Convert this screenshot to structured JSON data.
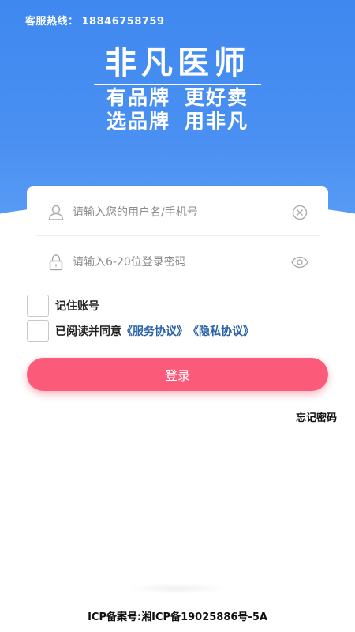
{
  "header": {
    "hotline_label": "客服热线：",
    "hotline_number": "18846758759"
  },
  "brand": {
    "title": "非凡医师",
    "slogan_line1_a": "有品牌",
    "slogan_line1_b": "更好卖",
    "slogan_line2_a": "选品牌",
    "slogan_line2_b": "用非凡"
  },
  "form": {
    "username_placeholder": "请输入您的用户名/手机号",
    "password_placeholder": "请输入6-20位登录密码",
    "remember_label": "记住账号",
    "agree_prefix": "已阅读并同意",
    "service_agreement": "《服务协议》",
    "privacy_agreement": "《隐私协议》",
    "login_button": "登录",
    "forgot_password": "忘记密码"
  },
  "footer": {
    "icp": "ICP备案号:湘ICP备19025886号-5A"
  },
  "colors": {
    "header_blue": "#4a90f2",
    "login_pink": "#fb5a78",
    "link_blue": "#2a62a8"
  },
  "icons": {
    "user": "user-icon",
    "clear": "clear-icon",
    "lock": "lock-icon",
    "eye": "eye-icon"
  }
}
